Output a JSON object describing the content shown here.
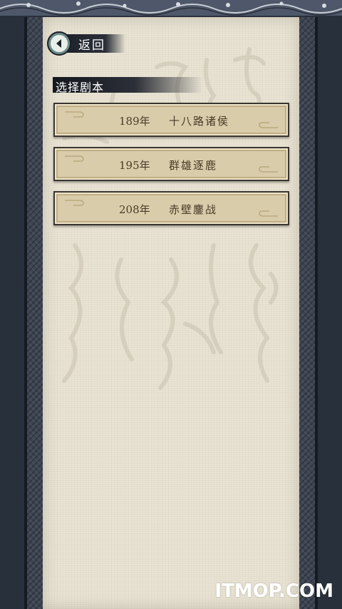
{
  "back": {
    "label": "返回",
    "icon": "back-arrow-icon"
  },
  "section": {
    "title": "选择剧本"
  },
  "scenarios": [
    {
      "year": "189年",
      "name": "十八路诸侯"
    },
    {
      "year": "195年",
      "name": "群雄逐鹿"
    },
    {
      "year": "208年",
      "name": "赤壁鏖战"
    }
  ],
  "watermark": "ITMOP.COM",
  "colors": {
    "frame": "#3d4553",
    "paper": "#e8e3d3",
    "card": "#d9ccaa",
    "card_text": "#4a3b28",
    "back_circle": "#6f8c8c"
  }
}
